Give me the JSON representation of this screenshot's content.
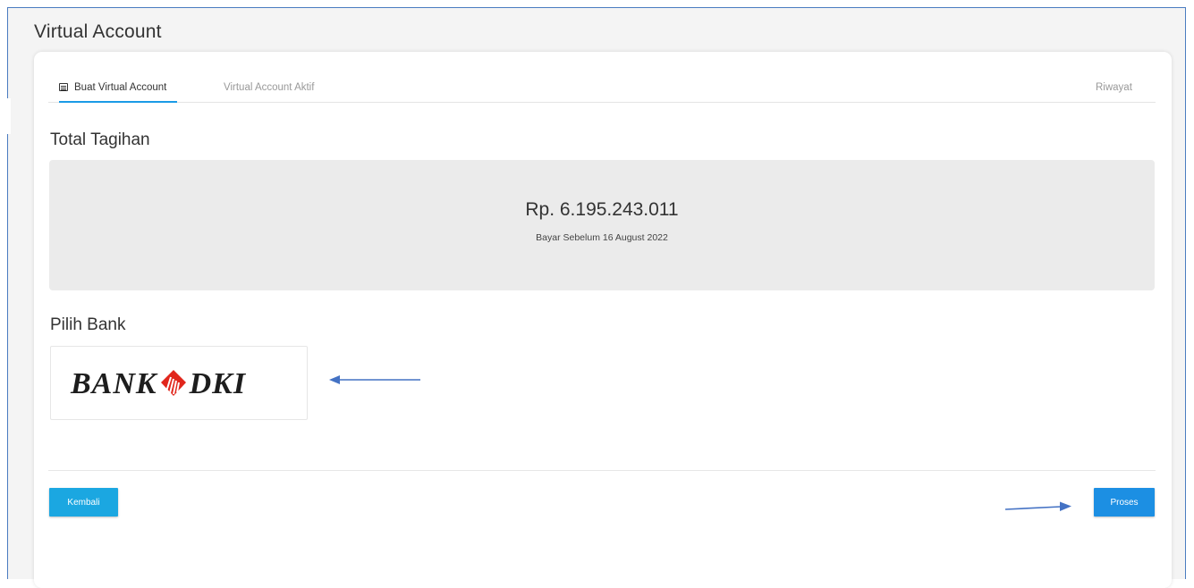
{
  "page": {
    "title": "Virtual Account"
  },
  "tabs": [
    {
      "label": "Buat Virtual Account",
      "icon": "list-icon",
      "active": true
    },
    {
      "label": "Virtual Account Aktif",
      "active": false
    },
    {
      "label": "Riwayat",
      "active": false
    }
  ],
  "summary": {
    "heading": "Total Tagihan",
    "amount": "Rp. 6.195.243.011",
    "due_text": "Bayar Sebelum 16 August 2022"
  },
  "bank_selection": {
    "heading": "Pilih Bank",
    "banks": [
      {
        "name": "BANK DKI",
        "logo_left": "BANK",
        "logo_right": "DKI",
        "logo_icon": "bank-dki-emblem-icon"
      }
    ]
  },
  "actions": {
    "back_label": "Kembali",
    "proceed_label": "Proses"
  },
  "colors": {
    "accent": "#1a9be6",
    "back_button": "#1ba7e1",
    "proceed_button": "#1c8fe3",
    "bank_logo_red": "#e1261c",
    "annotation_arrow": "#4472c4",
    "summary_background": "#ebebeb"
  }
}
